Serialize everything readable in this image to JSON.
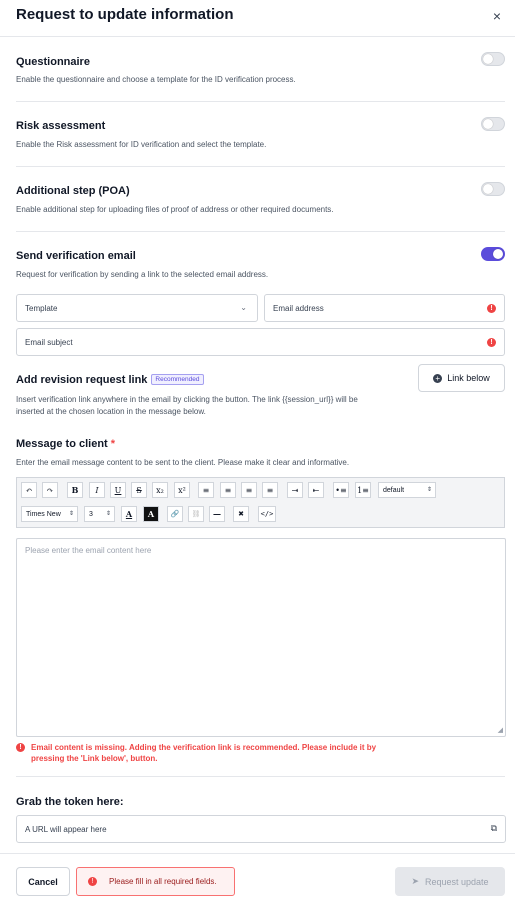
{
  "modal": {
    "title": "Request to update information",
    "close_glyph": "×"
  },
  "sections": {
    "questionnaire": {
      "title": "Questionnaire",
      "desc": "Enable the questionnaire and choose a template for the ID verification process.",
      "enabled": false
    },
    "risk": {
      "title": "Risk assessment",
      "desc": "Enable the Risk assessment for ID verification and select the template.",
      "enabled": false
    },
    "poa": {
      "title": "Additional step (POA)",
      "desc": "Enable additional step for uploading files of proof of address or other required documents.",
      "enabled": false
    },
    "email": {
      "title": "Send verification email",
      "desc": "Request for verification by sending a link to the selected email address.",
      "enabled": true,
      "template_label": "Template",
      "email_label": "Email address",
      "subject_label": "Email subject"
    },
    "revision": {
      "title": "Add revision request link",
      "badge": "Recommended",
      "desc_line1": "Insert verification link anywhere in the email by clicking the button. The link {{session_url}} will be",
      "desc_line2": "inserted at the chosen location in the message below.",
      "button": "Link below"
    },
    "message": {
      "title": "Message to client",
      "required_mark": "*",
      "desc": "Enter the email message content to be sent to the client. Please make it clear and informative.",
      "placeholder": "Please enter the email content here",
      "error_line1": "Email content is missing. Adding the verification link is recommended. Please include it by",
      "error_line2": "pressing the 'Link below', button."
    },
    "token": {
      "title": "Grab the token here:",
      "placeholder": "A URL will appear here"
    }
  },
  "toolbar": {
    "undo": "↶",
    "redo": "↷",
    "bold": "B",
    "italic": "I",
    "underline": "U",
    "strike": "S",
    "subscript": "x₂",
    "superscript": "x²",
    "align_left": "≡",
    "align_center": "≡",
    "align_right": "≡",
    "justify": "≡",
    "indent": "⇥",
    "outdent": "⇤",
    "bullets": "•≡",
    "numbers": "1≡",
    "format_value": "default",
    "font_value": "Times New",
    "size_value": "3",
    "text_color": "A",
    "bg_color": "A",
    "link": "🔗",
    "unlink": "⛓",
    "hr": "—",
    "clear": "✖",
    "code": "</>"
  },
  "footer": {
    "cancel": "Cancel",
    "alert": "Please fill in all required fields.",
    "submit": "Request update"
  },
  "colors": {
    "accent": "#5b4cdb",
    "error": "#ef4444"
  }
}
